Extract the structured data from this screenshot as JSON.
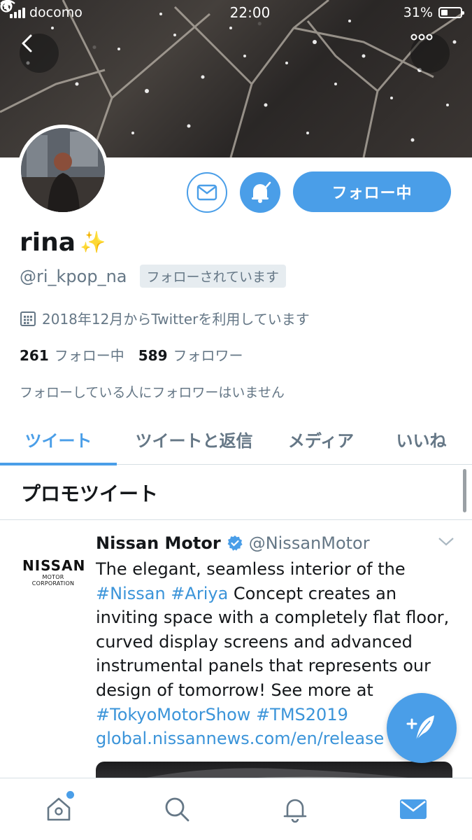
{
  "status_bar": {
    "carrier": "docomo",
    "time": "22:00",
    "battery_percent": "31%"
  },
  "profile": {
    "name": "rina",
    "name_emoji": "✨",
    "handle": "@ri_kpop_na",
    "follows_you_label": "フォローされています",
    "joined": "2018年12月からTwitterを利用しています",
    "following_count": "261",
    "following_label": "フォロー中",
    "followers_count": "589",
    "followers_label": "フォロワー",
    "no_mutual_followers": "フォローしている人にフォロワーはいません"
  },
  "actions": {
    "follow_button_label": "フォロー中"
  },
  "tabs": [
    {
      "label": "ツイート",
      "active": true
    },
    {
      "label": "ツイートと返信",
      "active": false
    },
    {
      "label": "メディア",
      "active": false
    },
    {
      "label": "いいね",
      "active": false
    }
  ],
  "section": {
    "title": "プロモツイート"
  },
  "tweet": {
    "author": "Nissan Motor",
    "handle": "@NissanMotor",
    "logo_word": "NISSAN",
    "logo_sub": "MOTOR CORPORATION",
    "text_1": "The elegant, seamless interior of the",
    "tag_1": "#Nissan",
    "tag_2": "#Ariya",
    "text_2": "Concept creates an inviting space with a completely flat floor, curved display screens and advanced instrumental panels that represents our design of tomorrow! See more at",
    "tag_3": "#TokyoMotorShow",
    "tag_4": "#TMS2019",
    "link": "global.nissannews.com/en/release"
  },
  "icons": {
    "back": "chevron-left-icon",
    "more": "more-horizontal-icon",
    "dm": "mail-icon",
    "bell": "bell-check-icon",
    "calendar": "calendar-icon",
    "verified": "verified-badge-icon",
    "caret": "chevron-down-icon",
    "compose": "compose-tweet-icon",
    "nav": [
      "home-icon",
      "search-icon",
      "notifications-icon",
      "messages-icon"
    ]
  },
  "colors": {
    "accent": "#4a9ee8",
    "link": "#3b94d9",
    "secondary_text": "#657786"
  }
}
